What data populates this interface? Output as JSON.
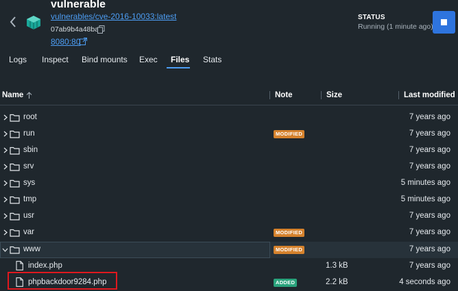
{
  "header": {
    "title": "vulnerable",
    "image_link": "vulnerables/cve-2016-10033:latest",
    "container_id": "07ab9b4a48ba",
    "port_link": "8080:80",
    "status_label": "STATUS",
    "status_text": "Running (1 minute ago)"
  },
  "tabs": [
    {
      "label": "Logs"
    },
    {
      "label": "Inspect"
    },
    {
      "label": "Bind mounts"
    },
    {
      "label": "Exec"
    },
    {
      "label": "Files",
      "active": true
    },
    {
      "label": "Stats"
    }
  ],
  "table": {
    "columns": [
      "Name",
      "Note",
      "Size",
      "Last modified"
    ],
    "rows": [
      {
        "name": "root",
        "type": "folder",
        "note": "",
        "size": "",
        "modified": "7 years ago"
      },
      {
        "name": "run",
        "type": "folder",
        "note": "MODIFIED",
        "size": "",
        "modified": "7 years ago"
      },
      {
        "name": "sbin",
        "type": "folder",
        "note": "",
        "size": "",
        "modified": "7 years ago"
      },
      {
        "name": "srv",
        "type": "folder",
        "note": "",
        "size": "",
        "modified": "7 years ago"
      },
      {
        "name": "sys",
        "type": "folder",
        "note": "",
        "size": "",
        "modified": "5 minutes ago"
      },
      {
        "name": "tmp",
        "type": "folder",
        "note": "",
        "size": "",
        "modified": "5 minutes ago"
      },
      {
        "name": "usr",
        "type": "folder",
        "note": "",
        "size": "",
        "modified": "7 years ago"
      },
      {
        "name": "var",
        "type": "folder",
        "note": "MODIFIED",
        "size": "",
        "modified": "7 years ago"
      },
      {
        "name": "www",
        "type": "folder-open",
        "note": "MODIFIED",
        "size": "",
        "modified": "7 years ago"
      },
      {
        "name": "index.php",
        "type": "file",
        "note": "",
        "size": "1.3 kB",
        "modified": "7 years ago"
      },
      {
        "name": "phpbackdoor9284.php",
        "type": "file",
        "note": "ADDED",
        "size": "2.2 kB",
        "modified": "4 seconds ago"
      }
    ]
  },
  "colors": {
    "background": "#1f272d",
    "accent": "#4d9ef5",
    "modified_badge": "#d5822d",
    "added_badge": "#2aa37c",
    "highlight": "#e0181e"
  }
}
